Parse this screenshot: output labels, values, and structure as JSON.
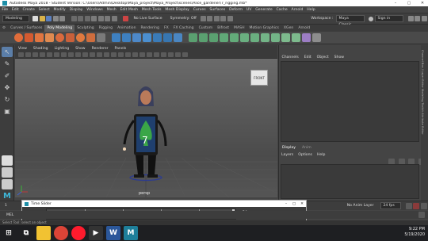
{
  "window": {
    "title": "Autodesk Maya 2018 - Student Version: C:\\Users\\Admin\\Desktop\\Maya_project\\Maya_Project\\scenes\\Alice_gardener\\7_rigging.mb*",
    "minimize": "–",
    "maximize": "▢",
    "close": "✕"
  },
  "menus": [
    "File",
    "Edit",
    "Create",
    "Select",
    "Modify",
    "Display",
    "Windows",
    "Mesh",
    "Edit Mesh",
    "Mesh Tools",
    "Mesh Display",
    "Curves",
    "Surfaces",
    "Deform",
    "UV",
    "Generate",
    "Cache",
    "Arnold",
    "Help"
  ],
  "status": {
    "mode": "Modeling",
    "live_surface": "No Live Surface",
    "symmetry": "Symmetry: Off",
    "workspace_label": "Workspace :",
    "workspace": "Maya Classic",
    "sign_in": "Sign in"
  },
  "shelf_tabs": [
    "Curves / Surfaces",
    "Poly Modeling",
    "Sculpting",
    "Rigging",
    "Animation",
    "Rendering",
    "FX",
    "FX Caching",
    "Custom",
    "Bifrost",
    "MASH",
    "Motion Graphics",
    "XGen",
    "Arnold"
  ],
  "shelf_active": "Poly Modeling",
  "viewport": {
    "menu": [
      "View",
      "Shading",
      "Lighting",
      "Show",
      "Renderer",
      "Panels"
    ],
    "camera_label": "persp",
    "cube_label": "FRONT",
    "character_number": "7"
  },
  "right_panel": {
    "channel_tabs": [
      "Channels",
      "Edit",
      "Object",
      "Show"
    ],
    "layer_tabs": [
      "Display",
      "Anim"
    ],
    "layer_menu": [
      "Layers",
      "Options",
      "Help"
    ],
    "side_tabs": "Channel Box / Layer Editor    Modeling Toolkit    Attribute Editor"
  },
  "time": {
    "start": "1",
    "slider_title": "Time Slider",
    "current_frame": "24",
    "end_frame": "24",
    "anim_layer": "No Anim Layer",
    "fps": "24 fps",
    "ticks": [
      "5",
      "10",
      "15",
      "20"
    ]
  },
  "command": {
    "lang": "MEL",
    "help": "Select Tool: select an object"
  },
  "taskbar": {
    "time": "9:22 PM",
    "date": "5/19/2020"
  },
  "colors": {
    "maya_blue": "#3fb7d8",
    "character_body": "#1a1a1a",
    "screen_blue": "#1f3f6e",
    "spade_green": "#3aa647",
    "active_tab": "#5d5d5d"
  }
}
